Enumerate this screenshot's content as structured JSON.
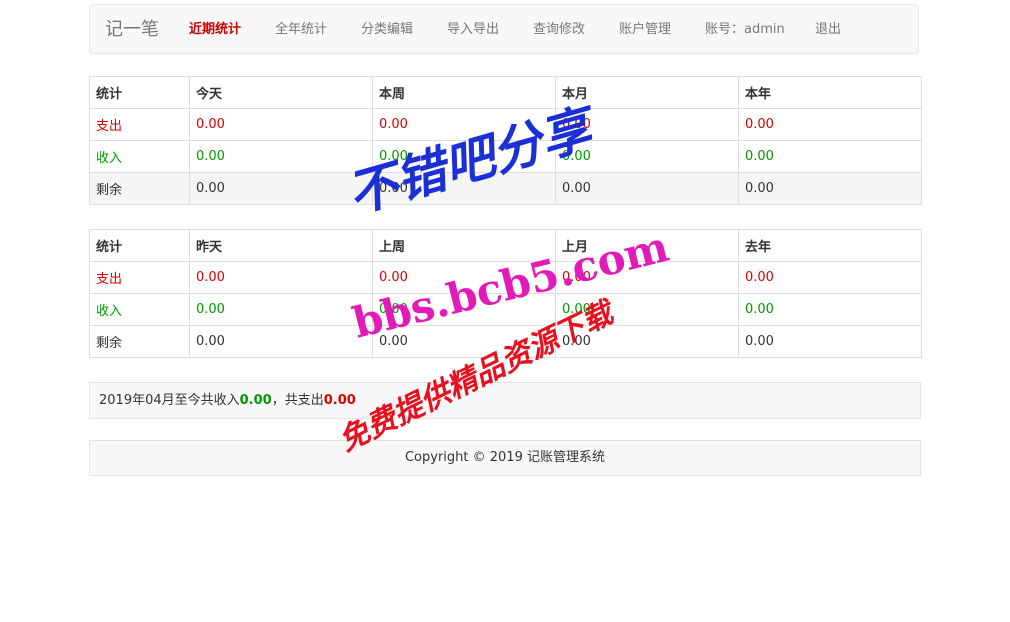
{
  "nav": {
    "brand": "记一笔",
    "items": [
      "近期统计",
      "全年统计",
      "分类编辑",
      "导入导出",
      "查询修改",
      "账户管理",
      "账号：admin",
      "退出"
    ]
  },
  "table1": {
    "headers": [
      "统计",
      "今天",
      "本周",
      "本月",
      "本年"
    ],
    "rows": [
      [
        "支出",
        "0.00",
        "0.00",
        "0.00",
        "0.00"
      ],
      [
        "收入",
        "0.00",
        "0.00",
        "0.00",
        "0.00"
      ],
      [
        "剩余",
        "0.00",
        "0.00",
        "0.00",
        "0.00"
      ]
    ]
  },
  "table2": {
    "headers": [
      "统计",
      "昨天",
      "上周",
      "上月",
      "去年"
    ],
    "rows": [
      [
        "支出",
        "0.00",
        "0.00",
        "0.00",
        "0.00"
      ],
      [
        "收入",
        "0.00",
        "0.00",
        "0.00",
        "0.00"
      ],
      [
        "剩余",
        "0.00",
        "0.00",
        "0.00",
        "0.00"
      ]
    ]
  },
  "summary": {
    "prefix": "2019年04月至今共收入",
    "income": "0.00",
    "middle": "，共支出",
    "expense": "0.00"
  },
  "footer": {
    "text": "Copyright © 2019 记账管理系统"
  },
  "watermark": {
    "line1": "不错吧分享",
    "line2": "bbs.bcb5.com",
    "line3": "免费提供精品资源下载"
  },
  "colors": {
    "expense": "#dd0000",
    "income": "#009900",
    "active_nav": "#cc0000"
  }
}
